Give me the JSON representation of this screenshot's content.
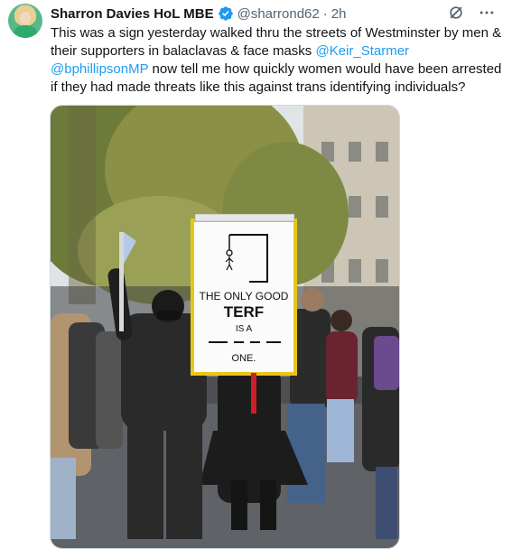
{
  "author": {
    "name": "Sharron Davies HoL MBE",
    "handle": "@sharrond62",
    "separator": "·",
    "time": "2h"
  },
  "tweet": {
    "text_1": "This was a sign yesterday walked thru the streets of Westminster by men & their supporters in balaclavas & face masks ",
    "mention_1": "@Keir_Starmer",
    "text_2": " ",
    "mention_2": "@bphillipsonMP",
    "text_3": " now tell me how quickly women would have been arrested if they had made threats like this against trans identifying individuals?"
  },
  "media": {
    "sign_line_1": "THE ONLY GOOD",
    "sign_line_2": "TERF",
    "sign_line_3": "IS A",
    "sign_line_4": "ONE."
  },
  "icons": {
    "verified": "verified-badge-icon",
    "grok": "grok-icon",
    "more": "more-options-icon"
  },
  "colors": {
    "link": "#1d9bf0",
    "secondary_text": "#536471",
    "sign_border": "#e8c51a"
  }
}
